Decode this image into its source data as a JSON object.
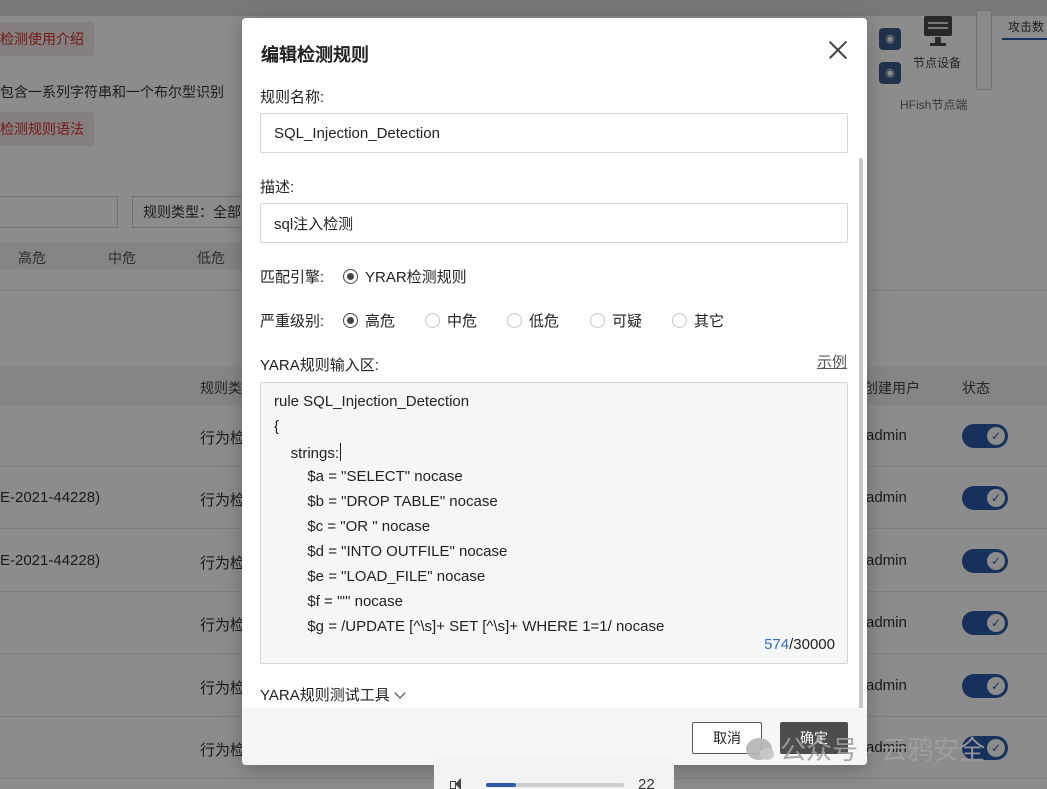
{
  "background": {
    "links": [
      "检测使用介绍",
      "检测规则语法"
    ],
    "description": "包含一系列字符串和一个布尔型识别",
    "filter_type": "规则类型：全部",
    "severity_tabs": [
      "高危",
      "中危",
      "低危"
    ],
    "table_headers": [
      "规则类",
      "创建用户",
      "状态"
    ],
    "rows": [
      {
        "name": "",
        "type": "行为检",
        "user": "admin"
      },
      {
        "name": "E-2021-44228)",
        "type": "行为检",
        "user": "admin"
      },
      {
        "name": "E-2021-44228)",
        "type": "行为检",
        "user": "admin"
      },
      {
        "name": "",
        "type": "行为检",
        "user": "admin"
      },
      {
        "name": "",
        "type": "行为检",
        "user": "admin"
      },
      {
        "name": "",
        "type": "行为检",
        "user": "admin"
      }
    ],
    "node_device": "节点设备",
    "node_end": "HFish节点端",
    "side_tab": "攻击数"
  },
  "modal": {
    "title": "编辑检测规则",
    "rule_name_label": "规则名称:",
    "rule_name_value": "SQL_Injection_Detection",
    "desc_label": "描述:",
    "desc_value": "sql注入检测",
    "engine_label": "匹配引擎:",
    "engine_option": "YRAR检测规则",
    "severity_label": "严重级别:",
    "severity_options": [
      "高危",
      "中危",
      "低危",
      "可疑",
      "其它"
    ],
    "severity_selected": "高危",
    "yara_label": "YARA规则输入区:",
    "example_link": "示例",
    "code_lines": [
      "rule SQL_Injection_Detection",
      "{",
      "    strings:",
      "        $a = \"SELECT\" nocase",
      "        $b = \"DROP TABLE\" nocase",
      "        $c = \"OR \" nocase",
      "        $d = \"INTO OUTFILE\" nocase",
      "        $e = \"LOAD_FILE\" nocase",
      "        $f = \"'\" nocase",
      "        $g = /UPDATE [^\\s]+ SET [^\\s]+ WHERE 1=1/ nocase"
    ],
    "char_count": "574",
    "char_limit": "/30000",
    "test_tool_label": "YARA规则测试工具",
    "cancel_label": "取消",
    "confirm_label": "确定"
  },
  "player": {
    "volume": "22",
    "volume_percent": 22
  },
  "watermark": "公众号 · 云鸦安全",
  "colors": {
    "accent": "#2c5aa8",
    "danger_text": "#d0302b",
    "primary_button": "#4d4d4d"
  }
}
